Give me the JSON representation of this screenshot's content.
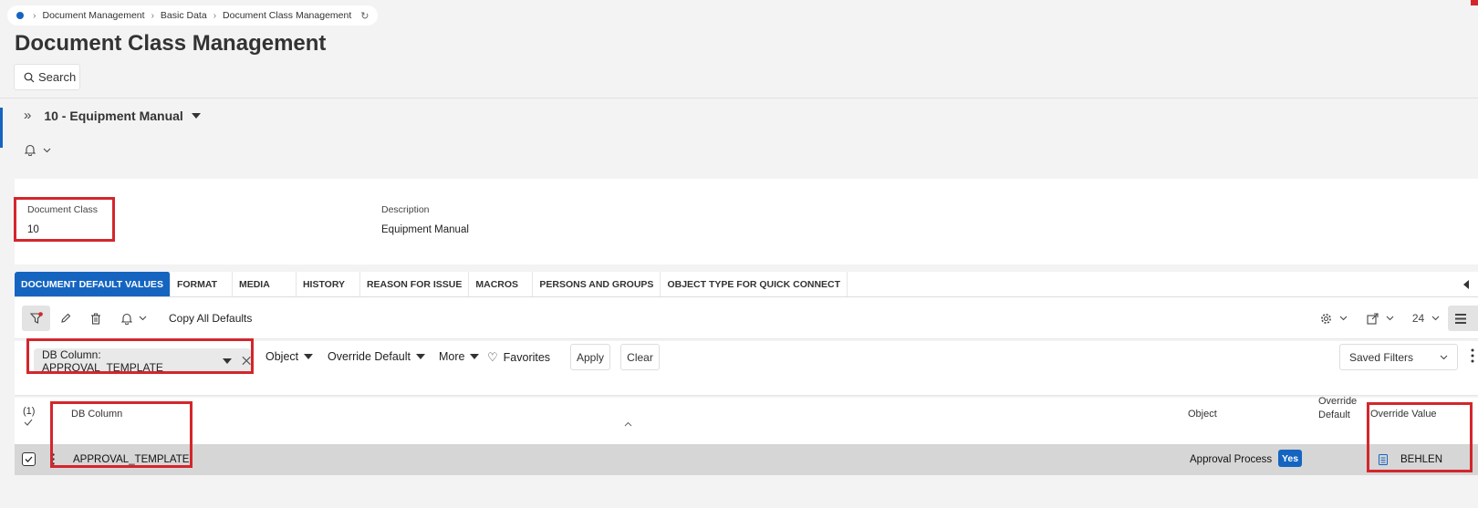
{
  "breadcrumb": [
    "Document Management",
    "Basic Data",
    "Document Class Management"
  ],
  "page_title": "Document Class Management",
  "search_label": "Search",
  "record_selector": "10 - Equipment Manual",
  "header_fields": {
    "doc_class_label": "Document Class",
    "doc_class_value": "10",
    "description_label": "Description",
    "description_value": "Equipment Manual"
  },
  "tabs": [
    "DOCUMENT DEFAULT VALUES",
    "FORMAT",
    "MEDIA",
    "HISTORY",
    "REASON FOR ISSUE",
    "MACROS",
    "PERSONS AND GROUPS",
    "OBJECT TYPE FOR QUICK CONNECT"
  ],
  "toolbar": {
    "copy_all_defaults": "Copy All Defaults",
    "page_size": "24"
  },
  "filters": {
    "chip": "DB Column: APPROVAL_TEMPLATE",
    "object": "Object",
    "override_default": "Override Default",
    "more": "More",
    "favorites": "Favorites",
    "apply": "Apply",
    "clear": "Clear",
    "saved_filters": "Saved Filters"
  },
  "table": {
    "selected_count": "(1)",
    "col_db_column": "DB Column",
    "col_object": "Object",
    "col_override_default_1": "Override",
    "col_override_default_2": "Default",
    "col_override_value": "Override Value",
    "rows": [
      {
        "db_column": "APPROVAL_TEMPLATE",
        "object": "Approval Process",
        "override_default": "Yes",
        "override_value": "BEHLEN"
      }
    ]
  },
  "colors": {
    "accent": "#1565c0",
    "highlight_box": "#d3262c"
  }
}
